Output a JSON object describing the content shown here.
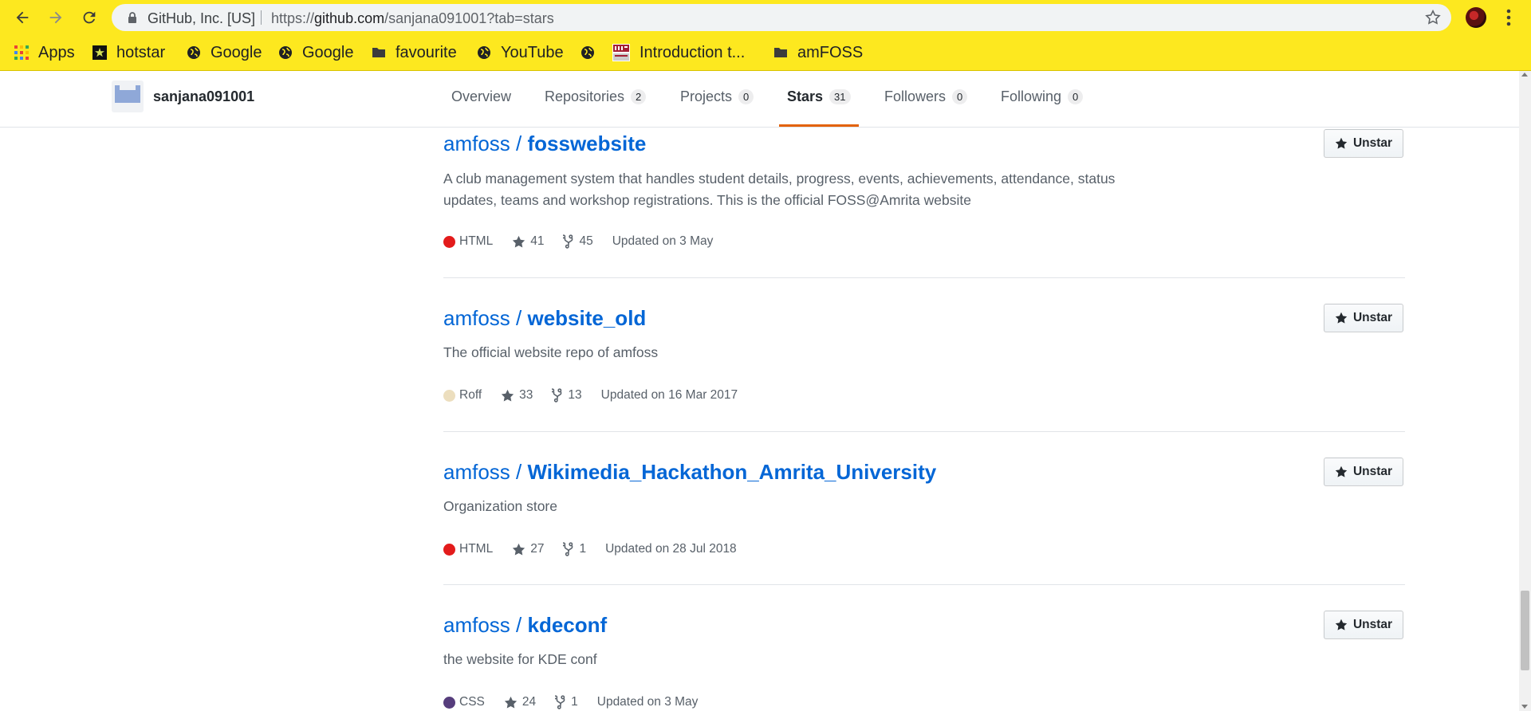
{
  "browser": {
    "site_identity": "GitHub, Inc. [US]",
    "url_prefix": "https://",
    "url_host": "github.com",
    "url_path": "/sanjana091001?tab=stars",
    "bookmarks": [
      {
        "label": "Apps",
        "icon": "apps-grid-icon"
      },
      {
        "label": "hotstar",
        "icon": "hotstar-favicon"
      },
      {
        "label": "Google",
        "icon": "globe-icon"
      },
      {
        "label": "Google",
        "icon": "globe-icon"
      },
      {
        "label": "favourite",
        "icon": "folder-icon"
      },
      {
        "label": "YouTube",
        "icon": "globe-icon"
      },
      {
        "label": "",
        "icon": "globe-icon"
      },
      {
        "label": "Introduction t...",
        "icon": "mit-ocw-favicon"
      },
      {
        "label": "amFOSS",
        "icon": "folder-icon"
      }
    ]
  },
  "profile": {
    "username": "sanjana091001",
    "tabs": [
      {
        "label": "Overview",
        "count": null
      },
      {
        "label": "Repositories",
        "count": "2"
      },
      {
        "label": "Projects",
        "count": "0"
      },
      {
        "label": "Stars",
        "count": "31",
        "active": true
      },
      {
        "label": "Followers",
        "count": "0"
      },
      {
        "label": "Following",
        "count": "0"
      }
    ]
  },
  "repos": [
    {
      "owner": "amfoss /",
      "name": "fosswebsite",
      "description": "A club management system that handles student details, progress, events, achievements, attendance, status updates, teams and workshop registrations. This is the official FOSS@Amrita website",
      "language": "HTML",
      "language_color": "#e34c26",
      "stars": "41",
      "forks": "45",
      "updated": "Updated on 3 May",
      "button": "Unstar"
    },
    {
      "owner": "amfoss /",
      "name": "website_old",
      "description": "The official website repo of amfoss",
      "language": "Roff",
      "language_color": "#ecdebe",
      "stars": "33",
      "forks": "13",
      "updated": "Updated on 16 Mar 2017",
      "button": "Unstar"
    },
    {
      "owner": "amfoss /",
      "name": "Wikimedia_Hackathon_Amrita_University",
      "description": "Organization store",
      "language": "HTML",
      "language_color": "#e34c26",
      "stars": "27",
      "forks": "1",
      "updated": "Updated on 28 Jul 2018",
      "button": "Unstar"
    },
    {
      "owner": "amfoss /",
      "name": "kdeconf",
      "description": "the website for KDE conf",
      "language": "CSS",
      "language_color": "#563d7c",
      "stars": "24",
      "forks": "1",
      "updated": "Updated on 3 May",
      "button": "Unstar"
    }
  ]
}
